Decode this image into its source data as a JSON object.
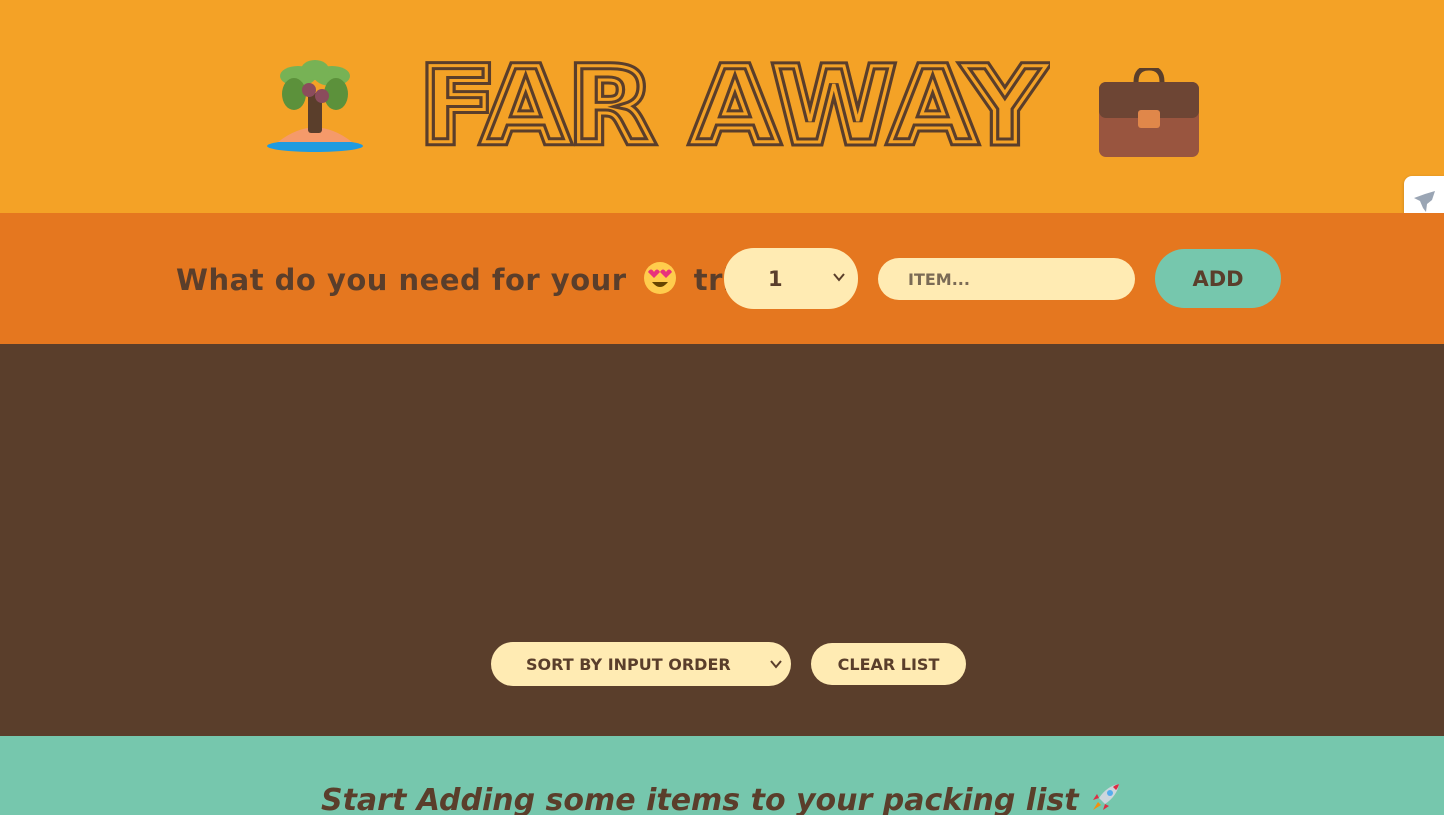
{
  "header": {
    "title": "FAR AWAY",
    "left_icon": "palm-island-icon",
    "right_icon": "briefcase-icon"
  },
  "form": {
    "prompt": "What do you need for your 😍 trip?",
    "prompt_before": "What do you need for your",
    "prompt_after": "trip?",
    "prompt_emoji_icon": "heart-eyes-face-icon",
    "quantity_value": "1",
    "item_placeholder": "ITEM...",
    "add_label": "ADD"
  },
  "actions": {
    "sort_value": "SORT BY INPUT ORDER",
    "clear_label": "CLEAR LIST"
  },
  "stats": {
    "message": "Start Adding some items to your packing list",
    "message_icon": "rocket-icon"
  },
  "colors": {
    "header_bg": "#f4a226",
    "form_bg": "#e5771f",
    "list_bg": "#5a3e2b",
    "stats_bg": "#76c7ad",
    "input_bg": "#ffebb3",
    "text_dark": "#5a3e2b"
  },
  "side_tab_icon": "extension-icon"
}
